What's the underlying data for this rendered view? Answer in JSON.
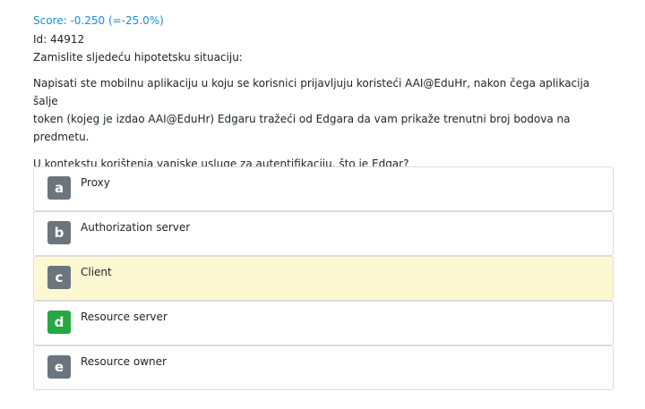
{
  "score": "Score: -0.250 (=-25.0%)",
  "id_line": "Id: 44912",
  "intro": "Zamislite sljedeću hipotetsku situaciju:",
  "scenario_lines": [
    "Napisati ste mobilnu aplikaciju u koju se korisnici prijavljuju koristeći AAI@EduHr, nakon čega aplikacija šalje",
    "token (kojeg je izdao AAI@EduHr) Edgaru tražeći od Edgara da vam prikaže trenutni broj bodova na",
    "predmetu."
  ],
  "question": "U kontekstu korištenja vanjske usluge za autentifikaciju, što je Edgar?",
  "answers": [
    {
      "letter": "a",
      "text": "Proxy",
      "state": "default"
    },
    {
      "letter": "b",
      "text": "Authorization server",
      "state": "default"
    },
    {
      "letter": "c",
      "text": "Client",
      "state": "selected"
    },
    {
      "letter": "d",
      "text": "Resource server",
      "state": "correct"
    },
    {
      "letter": "e",
      "text": "Resource owner",
      "state": "default"
    }
  ],
  "colors": {
    "score": "#1a8fd6",
    "badge_default": "#6c757d",
    "badge_correct": "#28a745",
    "selected_background": "#fcf8d2",
    "border": "#dcdcdc"
  }
}
